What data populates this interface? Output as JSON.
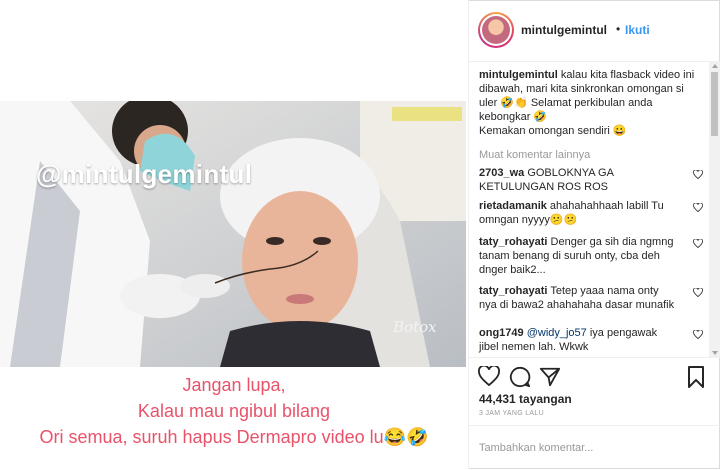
{
  "post": {
    "watermark": "@mintulgemintul",
    "video_label": "Botox",
    "overlay_lines": [
      "Jangan lupa,",
      "Kalau mau ngibul bilang",
      "Ori semua, suruh hapus Dermapro video lu😂🤣"
    ]
  },
  "header": {
    "username": "mintulgemintul",
    "dot": "•",
    "follow_label": "Ikuti"
  },
  "caption": {
    "username": "mintulgemintul",
    "text": " kalau kita flasback video ini dibawah, mari kita sinkronkan omongan si uler 🤣👏 Selamat perkibulan anda kebongkar 🤣",
    "text2": "Kemakan omongan sendiri 😀"
  },
  "more_comments_label": "Muat komentar lainnya",
  "comments": [
    {
      "user": "2703_wa",
      "text": " GOBLOKNYA GA KETULUNGAN ROS ROS"
    },
    {
      "user": "rietadamanik",
      "text": " ahahahahhaah labill Tu omngan nyyyy😕😕"
    },
    {
      "user": "taty_rohayati",
      "text": " Denger ga sih dia ngmng tanam benang di suruh onty, cba deh dnger baik2..."
    },
    {
      "user": "taty_rohayati",
      "text": " Tetep yaaa nama onty nya di bawa2 ahahahaha dasar munafik"
    },
    {
      "user": "ong1749",
      "mention": "@widy_jo57",
      "text": " iya pengawak jibel nemen lah. Wkwk"
    }
  ],
  "stats": {
    "views": "44,431 tayangan",
    "time": "3 JAM YANG LALU"
  },
  "add_comment": {
    "placeholder": "Tambahkan komentar..."
  },
  "colors": {
    "accent": "#3897f0",
    "overlay_text": "#e8536a"
  }
}
